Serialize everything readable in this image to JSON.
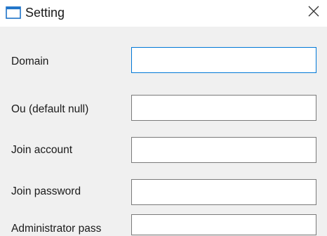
{
  "window": {
    "title": "Setting",
    "icon": "window-icon",
    "close_icon": "close-icon"
  },
  "form": {
    "fields": [
      {
        "label": "Domain",
        "value": "",
        "focused": true
      },
      {
        "label": "Ou (default null)",
        "value": "",
        "focused": false
      },
      {
        "label": "Join account",
        "value": "",
        "focused": false
      },
      {
        "label": "Join password",
        "value": "",
        "focused": false
      },
      {
        "label": "Administrator pass",
        "value": "",
        "focused": false
      }
    ]
  },
  "colors": {
    "focus_border": "#0078d7",
    "field_border": "#7a7a7a",
    "background": "#f0f0f0",
    "titlebar": "#ffffff"
  }
}
